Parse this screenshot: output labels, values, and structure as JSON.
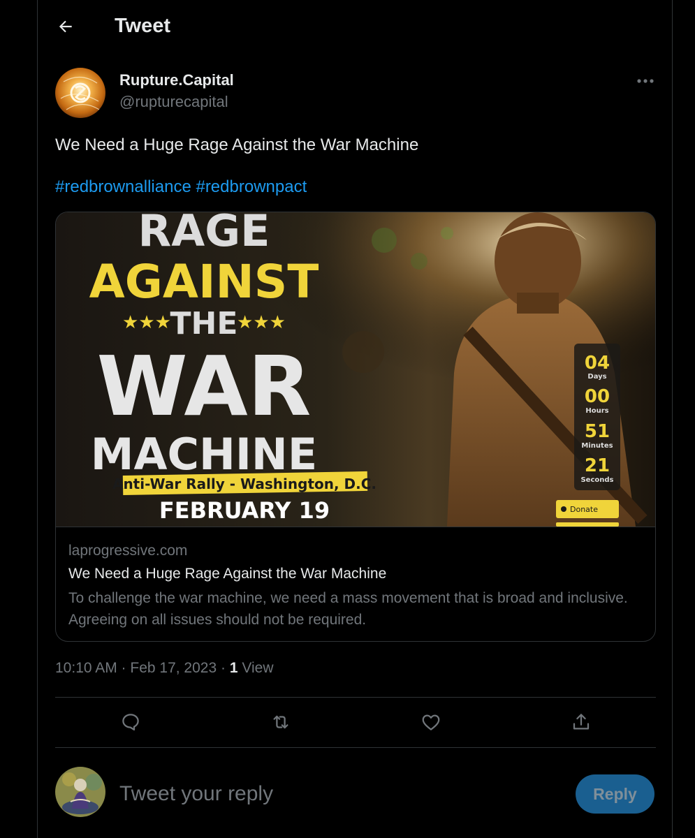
{
  "header": {
    "title": "Tweet"
  },
  "tweet": {
    "author_name": "Rupture.Capital",
    "author_handle": "@rupturecapital",
    "text": "We Need a Huge Rage Against the War Machine",
    "hashtags": [
      "#redbrownalliance",
      "#redbrownpact"
    ],
    "timestamp": "10:10 AM · Feb 17, 2023 · ",
    "views_count": "1",
    "views_label": " View"
  },
  "card": {
    "domain": "laprogressive.com",
    "title": "We Need a Huge Rage Against the War Machine",
    "description": "To challenge the war machine, we need a mass movement that is broad and inclusive. Agreeing on all issues should not be required.",
    "image": {
      "line_rage": "RAGE",
      "line_against": "AGAINST",
      "line_the": "THE",
      "line_war": "WAR",
      "line_machine": "MACHINE",
      "stars_left": "★★★",
      "stars_right": "★★★",
      "banner": "Anti-War Rally - Washington, D.C.",
      "date": "FEBRUARY 19",
      "countdown": [
        {
          "value": "04",
          "label": "Days"
        },
        {
          "value": "00",
          "label": "Hours"
        },
        {
          "value": "51",
          "label": "Minutes"
        },
        {
          "value": "21",
          "label": "Seconds"
        }
      ],
      "donate_label": "Donate"
    }
  },
  "reply": {
    "placeholder": "Tweet your reply",
    "button_label": "Reply"
  },
  "colors": {
    "background": "#000000",
    "text": "#e7e9ea",
    "muted": "#71767b",
    "accent": "#1d9bf0",
    "border": "#2f3336",
    "poster_yellow": "#f0d43a"
  },
  "icons": [
    "back-arrow-icon",
    "more-dots-icon",
    "reply-icon",
    "retweet-icon",
    "like-icon",
    "share-icon"
  ]
}
